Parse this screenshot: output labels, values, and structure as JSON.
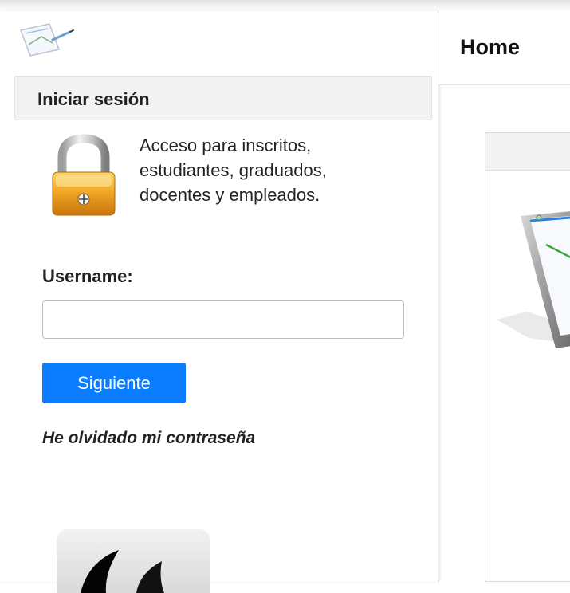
{
  "sidebar": {
    "logo_icon": "pen-tablet-logo-icon",
    "panel_title": "Iniciar sesión",
    "lock_icon": "padlock-icon",
    "access_lines": [
      "Acceso para inscritos,",
      "estudiantes, graduados,",
      "docentes y empleados."
    ],
    "username_label": "Username:",
    "username_value": "",
    "next_button_label": "Siguiente",
    "forgot_password_link": "He olvidado mi contraseña",
    "app_tile_icon": "app-tile-icon"
  },
  "main": {
    "page_title": "Home",
    "card_image_icon": "tablet-illustration-icon"
  },
  "colors": {
    "primary_button": "#0a7cff",
    "panel_header_bg": "#f3f3f3",
    "lock_body": "#e59a1a"
  }
}
